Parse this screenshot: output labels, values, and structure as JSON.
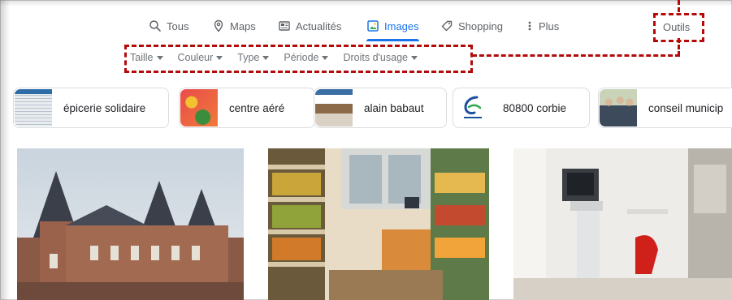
{
  "tabs": [
    {
      "label": "Tous",
      "icon": "search-icon"
    },
    {
      "label": "Maps",
      "icon": "map-pin-icon"
    },
    {
      "label": "Actualités",
      "icon": "news-icon"
    },
    {
      "label": "Images",
      "icon": "image-icon",
      "active": true
    },
    {
      "label": "Shopping",
      "icon": "tag-icon"
    },
    {
      "label": "Plus",
      "icon": "more-vert-icon"
    }
  ],
  "tools": {
    "label": "Outils"
  },
  "filters": [
    {
      "label": "Taille"
    },
    {
      "label": "Couleur"
    },
    {
      "label": "Type"
    },
    {
      "label": "Période"
    },
    {
      "label": "Droits d'usage"
    }
  ],
  "chips": [
    {
      "label": "épicerie solidaire"
    },
    {
      "label": "centre aéré"
    },
    {
      "label": "alain babaut"
    },
    {
      "label": "80800 corbie"
    },
    {
      "label": "conseil municip"
    }
  ],
  "colors": {
    "accent": "#1a73e8",
    "annotation": "#b40a0a",
    "text": "#202124",
    "muted": "#70757a"
  }
}
